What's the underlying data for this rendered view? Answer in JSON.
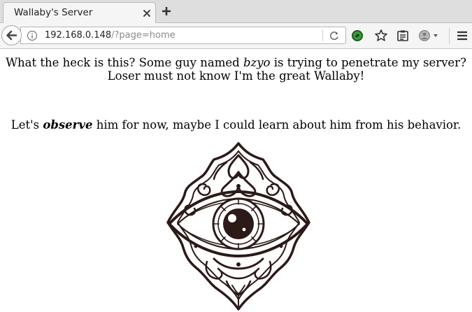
{
  "tab": {
    "title": "Wallaby's Server"
  },
  "address_bar": {
    "host": "192.168.0.148",
    "path": "/?page=home"
  },
  "content": {
    "line1_pre": "What the heck is this? Some guy named ",
    "line1_em": "bzyo",
    "line1_post": " is trying to penetrate my server?",
    "line2": "Loser must not know I'm the great Wallaby!",
    "line3_pre": "Let's ",
    "line3_em": "observe",
    "line3_post": " him for now, maybe I could learn about him from his behavior."
  },
  "icons": {
    "tab_close": "close-icon",
    "new_tab": "plus-icon",
    "back": "back-arrow-icon",
    "site_info": "info-icon",
    "reload": "reload-icon",
    "extension": "extension-icon",
    "bookmark": "star-icon",
    "reader": "reader-view-icon",
    "profile": "profile-icon",
    "menu": "hamburger-menu-icon",
    "art": "all-seeing-eye-icon"
  },
  "colors": {
    "ink": "#2b1a17",
    "url_path": "#8a8a8a",
    "extension_green": "#2f7d2f"
  }
}
